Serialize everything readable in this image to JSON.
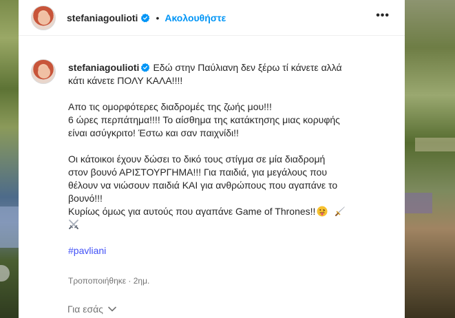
{
  "post": {
    "username": "stefaniagoulioti",
    "separator": "•",
    "follow_label": "Ακολουθήστε",
    "more_label": "•••"
  },
  "caption": {
    "username": "stefaniagoulioti",
    "line1": "Εδώ στην Παύλιανη δεν ξέρω τί κάνετε αλλά",
    "line2": "κάτι κάνετε ΠΟΛΥ ΚΑΛΑ!!!!",
    "para2_line1": "Απο τις ομορφότερες διαδρομές της ζωής μου!!!",
    "para2_line2": "6 ώρες περπάτημα!!!! Το αίσθημα της κατάκτησης μιας κορυφής",
    "para2_line3": "είναι ασύγκριτο! Έστω και σαν παιχνίδι!!",
    "para3_line1": "Οι κάτοικοι έχουν δώσει το δικό τους στίγμα σε μία διαδρομή",
    "para3_line2": "στον βουνό ΑΡΙΣΤΟΥΡΓΗΜΑ!!! Για παιδιά, για μεγάλους που",
    "para3_line3": "θέλουν να νιώσουν παιδιά ΚΑΙ για ανθρώπους που αγαπάνε το",
    "para3_line4": "βουνό!!!",
    "para3_line5": "Κυρίως όμως για αυτούς που αγαπάνε Game of Thrones!!",
    "hashtag": "#pavliani"
  },
  "meta": {
    "edited": "Τροποποιήθηκε · 2ημ."
  },
  "footer": {
    "for_you": "Για εσάς"
  },
  "colors": {
    "accent": "#0095f6",
    "hashtag": "#4150f7",
    "muted": "#737373"
  },
  "icons": [
    "verified-icon",
    "more-options-icon",
    "tongue-emoji-icon",
    "dagger-emoji-icon",
    "crossed-swords-emoji-icon",
    "chevron-down-icon"
  ]
}
